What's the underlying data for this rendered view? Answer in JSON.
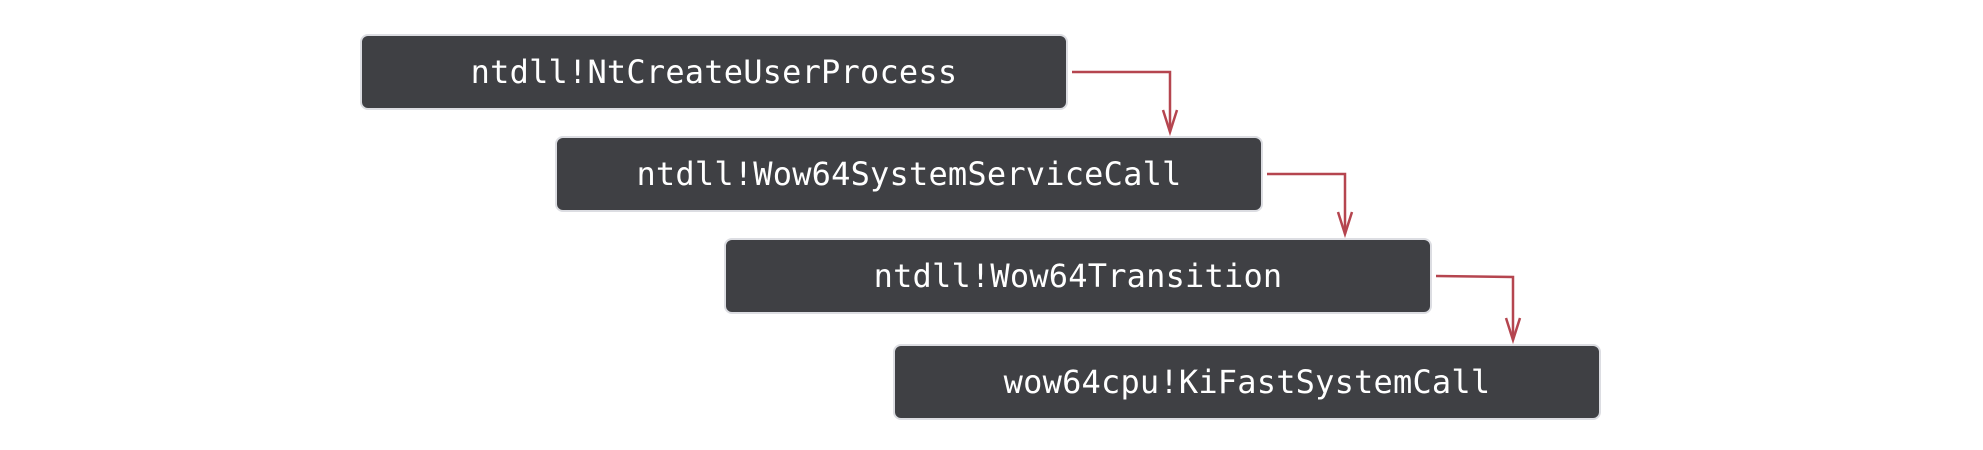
{
  "diagram": {
    "nodes": [
      {
        "id": "n1",
        "label": "ntdll!NtCreateUserProcess"
      },
      {
        "id": "n2",
        "label": "ntdll!Wow64SystemServiceCall"
      },
      {
        "id": "n3",
        "label": "ntdll!Wow64Transition"
      },
      {
        "id": "n4",
        "label": "wow64cpu!KiFastSystemCall"
      }
    ],
    "edges": [
      {
        "from": "n1",
        "to": "n2"
      },
      {
        "from": "n2",
        "to": "n3"
      },
      {
        "from": "n3",
        "to": "n4"
      }
    ],
    "colors": {
      "node_fill": "#3f4044",
      "node_border": "#dcdde2",
      "node_text": "#ffffff",
      "connector": "#b5454f",
      "background": "#ffffff"
    }
  }
}
